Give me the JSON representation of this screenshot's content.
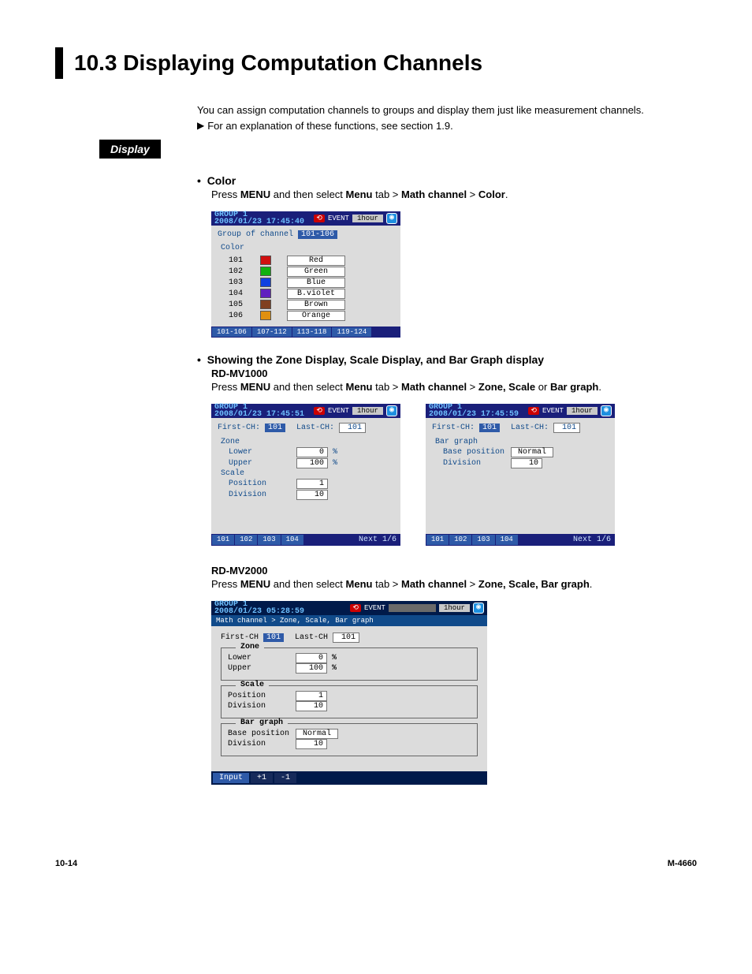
{
  "title": "10.3  Displaying Computation Channels",
  "intro": "You can assign computation channels to groups and display them just like measurement channels.",
  "note_triangle": "▶",
  "note_text": "For an explanation of these functions, see section 1.9.",
  "side_label": "Display",
  "sec_color": {
    "bullet": "Color",
    "instr_pre": "Press ",
    "instr_b1": "MENU",
    "instr_mid1": " and then select ",
    "instr_b2": "Menu",
    "instr_mid2": " tab > ",
    "instr_b3": "Math channel",
    "instr_mid3": " > ",
    "instr_b4": "Color",
    "instr_end": "."
  },
  "color_screen": {
    "group_title": "GROUP 1",
    "timestamp": "2008/01/23 17:45:40",
    "event_icon": "⟲",
    "event_text": "EVENT",
    "time_box": "1hour",
    "camera": "◉",
    "group_line_pre": "Group of channel",
    "group_chip": "101-106",
    "section": "Color",
    "rows": [
      {
        "ch": "101",
        "color": "#d01010",
        "name": "Red"
      },
      {
        "ch": "102",
        "color": "#10b010",
        "name": "Green"
      },
      {
        "ch": "103",
        "color": "#1040e0",
        "name": "Blue"
      },
      {
        "ch": "104",
        "color": "#6020c0",
        "name": "B.violet"
      },
      {
        "ch": "105",
        "color": "#804020",
        "name": "Brown"
      },
      {
        "ch": "106",
        "color": "#e09010",
        "name": "Orange"
      }
    ],
    "tabs": [
      "101-106",
      "107-112",
      "113-118",
      "119-124"
    ]
  },
  "sec_zone": {
    "bullet": "Showing the Zone Display, Scale Display, and Bar Graph display",
    "model1": "RD-MV1000",
    "instr1_pre": "Press ",
    "instr1_b1": "MENU",
    "instr1_mid1": " and then select ",
    "instr1_b2": "Menu",
    "instr1_mid2": " tab > ",
    "instr1_b3": "Math channel",
    "instr1_mid3": " > ",
    "instr1_b4": "Zone, Scale",
    "instr1_mid4": " or ",
    "instr1_b5": "Bar graph",
    "instr1_end": "."
  },
  "zone_screen_left": {
    "group_title": "GROUP 1",
    "timestamp": "2008/01/23 17:45:51",
    "first_label": "First-CH:",
    "first_val": "101",
    "last_label": "Last-CH:",
    "last_val": "101",
    "zone_label": "Zone",
    "lower_label": "Lower",
    "lower_val": "0",
    "upper_label": "Upper",
    "upper_val": "100",
    "pct": "%",
    "scale_label": "Scale",
    "pos_label": "Position",
    "pos_val": "1",
    "div_label": "Division",
    "div_val": "10",
    "tabs": [
      "101",
      "102",
      "103",
      "104"
    ],
    "next": "Next 1/6"
  },
  "zone_screen_right": {
    "group_title": "GROUP 1",
    "timestamp": "2008/01/23 17:45:59",
    "first_label": "First-CH:",
    "first_val": "101",
    "last_label": "Last-CH:",
    "last_val": "101",
    "bar_label": "Bar graph",
    "base_label": "Base position",
    "base_val": "Normal",
    "div_label": "Division",
    "div_val": "10",
    "tabs": [
      "101",
      "102",
      "103",
      "104"
    ],
    "next": "Next 1/6"
  },
  "sec_mv2000": {
    "model": "RD-MV2000",
    "instr_pre": "Press ",
    "instr_b1": "MENU",
    "instr_mid1": " and then select ",
    "instr_b2": "Menu",
    "instr_mid2": " tab > ",
    "instr_b3": "Math channel",
    "instr_mid3": " > ",
    "instr_b4": "Zone, Scale, Bar graph",
    "instr_end": "."
  },
  "mv2000_screen": {
    "group_title": "GROUP 1",
    "timestamp": "2008/01/23 05:28:59",
    "event_icon": "⟲",
    "event_label": "EVENT",
    "time_box": "1hour",
    "camera": "◉",
    "breadcrumb": "Math channel > Zone, Scale, Bar graph",
    "first_label": "First-CH",
    "first_val": "101",
    "last_label": "Last-CH",
    "last_val": "101",
    "box_zone": {
      "legend": "Zone",
      "lower_label": "Lower",
      "lower_val": "0",
      "upper_label": "Upper",
      "upper_val": "100",
      "pct": "%"
    },
    "box_scale": {
      "legend": "Scale",
      "pos_label": "Position",
      "pos_val": "1",
      "div_label": "Division",
      "div_val": "10"
    },
    "box_bar": {
      "legend": "Bar graph",
      "base_label": "Base position",
      "base_val": "Normal",
      "div_label": "Division",
      "div_val": "10"
    },
    "footer": [
      "Input",
      "+1",
      "-1"
    ]
  },
  "page_num": "10-14",
  "doc_code": "M-4660"
}
